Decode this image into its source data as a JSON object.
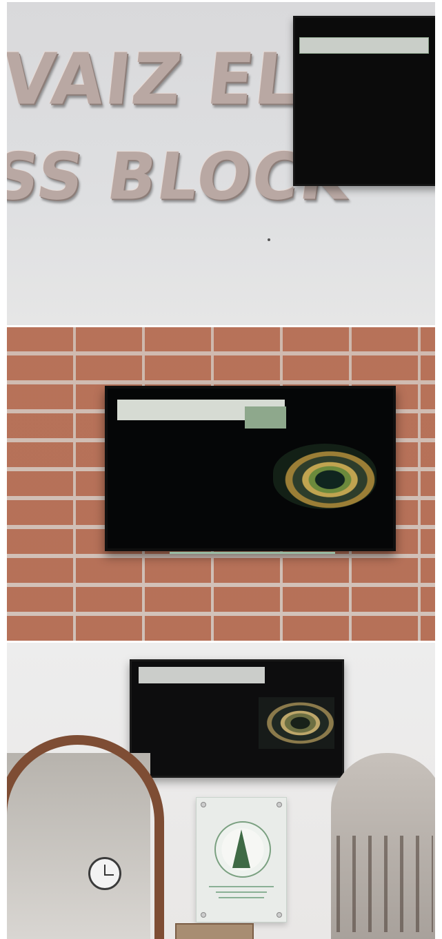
{
  "panel_1": {
    "sign_line_1": "VAIZ ELAHI",
    "sign_line_2": "SS BLOCK"
  },
  "colors": {
    "brick": "#b97a5c",
    "wall": "#dfe0e2",
    "screen": "#050607",
    "wood": "#7e4d34"
  }
}
